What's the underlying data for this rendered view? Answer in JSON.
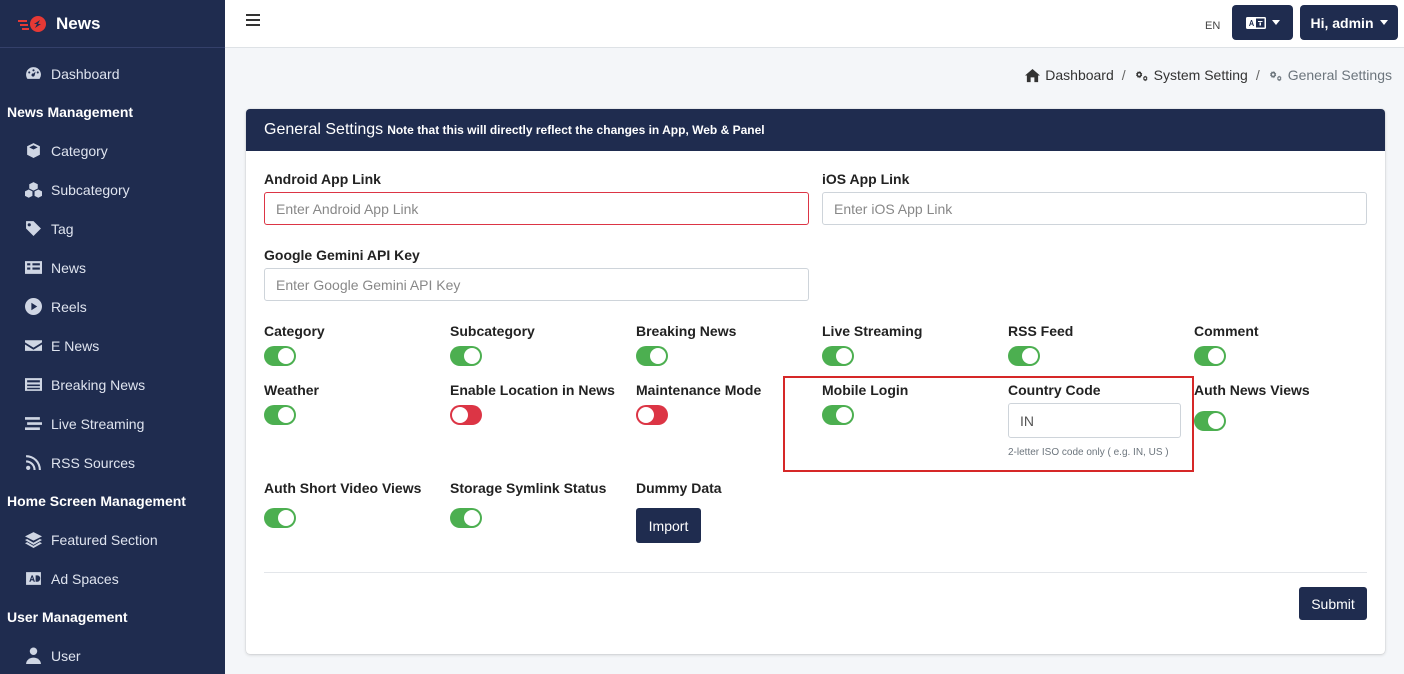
{
  "brand": {
    "name": "News"
  },
  "sidebar": {
    "items": [
      {
        "label": "Dashboard",
        "icon": "dashboard-icon"
      },
      {
        "header": "News Management"
      },
      {
        "label": "Category",
        "icon": "cube-icon"
      },
      {
        "label": "Subcategory",
        "icon": "cubes-icon"
      },
      {
        "label": "Tag",
        "icon": "tag-icon"
      },
      {
        "label": "News",
        "icon": "news-list-icon"
      },
      {
        "label": "Reels",
        "icon": "play-circle-icon"
      },
      {
        "label": "E News",
        "icon": "envelope-icon"
      },
      {
        "label": "Breaking News",
        "icon": "newspaper-icon"
      },
      {
        "label": "Live Streaming",
        "icon": "stream-icon"
      },
      {
        "label": "RSS Sources",
        "icon": "rss-icon"
      },
      {
        "header": "Home Screen Management"
      },
      {
        "label": "Featured Section",
        "icon": "layers-icon"
      },
      {
        "label": "Ad Spaces",
        "icon": "ad-icon"
      },
      {
        "header": "User Management"
      },
      {
        "label": "User",
        "icon": "user-icon"
      }
    ]
  },
  "topbar": {
    "lang": "EN",
    "user_label": "Hi, admin",
    "lang_icon": "language-icon"
  },
  "breadcrumb": [
    "Dashboard",
    "System Setting",
    "General Settings"
  ],
  "card": {
    "title": "General Settings",
    "note": "Note that this will directly reflect the changes in App, Web & Panel"
  },
  "fields": {
    "android": {
      "label": "Android App Link",
      "placeholder": "Enter Android App Link"
    },
    "ios": {
      "label": "iOS App Link",
      "placeholder": "Enter iOS App Link"
    },
    "gemini": {
      "label": "Google Gemini API Key",
      "placeholder": "Enter Google Gemini API Key"
    },
    "country": {
      "label": "Country Code",
      "value": "IN",
      "help": "2-letter ISO code only ( e.g. IN, US )"
    }
  },
  "toggles": {
    "category": {
      "label": "Category",
      "on": true
    },
    "subcategory": {
      "label": "Subcategory",
      "on": true
    },
    "breaking": {
      "label": "Breaking News",
      "on": true
    },
    "live": {
      "label": "Live Streaming",
      "on": true
    },
    "rss": {
      "label": "RSS Feed",
      "on": true
    },
    "comment": {
      "label": "Comment",
      "on": true
    },
    "weather": {
      "label": "Weather",
      "on": true
    },
    "location": {
      "label": "Enable Location in News",
      "on": false
    },
    "maintenance": {
      "label": "Maintenance Mode",
      "on": false
    },
    "mobile_login": {
      "label": "Mobile Login",
      "on": true
    },
    "auth_news": {
      "label": "Auth News Views",
      "on": true
    },
    "auth_short": {
      "label": "Auth Short Video Views",
      "on": true
    },
    "symlink": {
      "label": "Storage Symlink Status",
      "on": true
    }
  },
  "dummy": {
    "label": "Dummy Data",
    "button": "Import"
  },
  "submit": "Submit",
  "colors": {
    "primary": "#1f2c4f",
    "toggle_on": "#4caf50",
    "toggle_off": "#dc3545",
    "highlight": "#d62828"
  }
}
